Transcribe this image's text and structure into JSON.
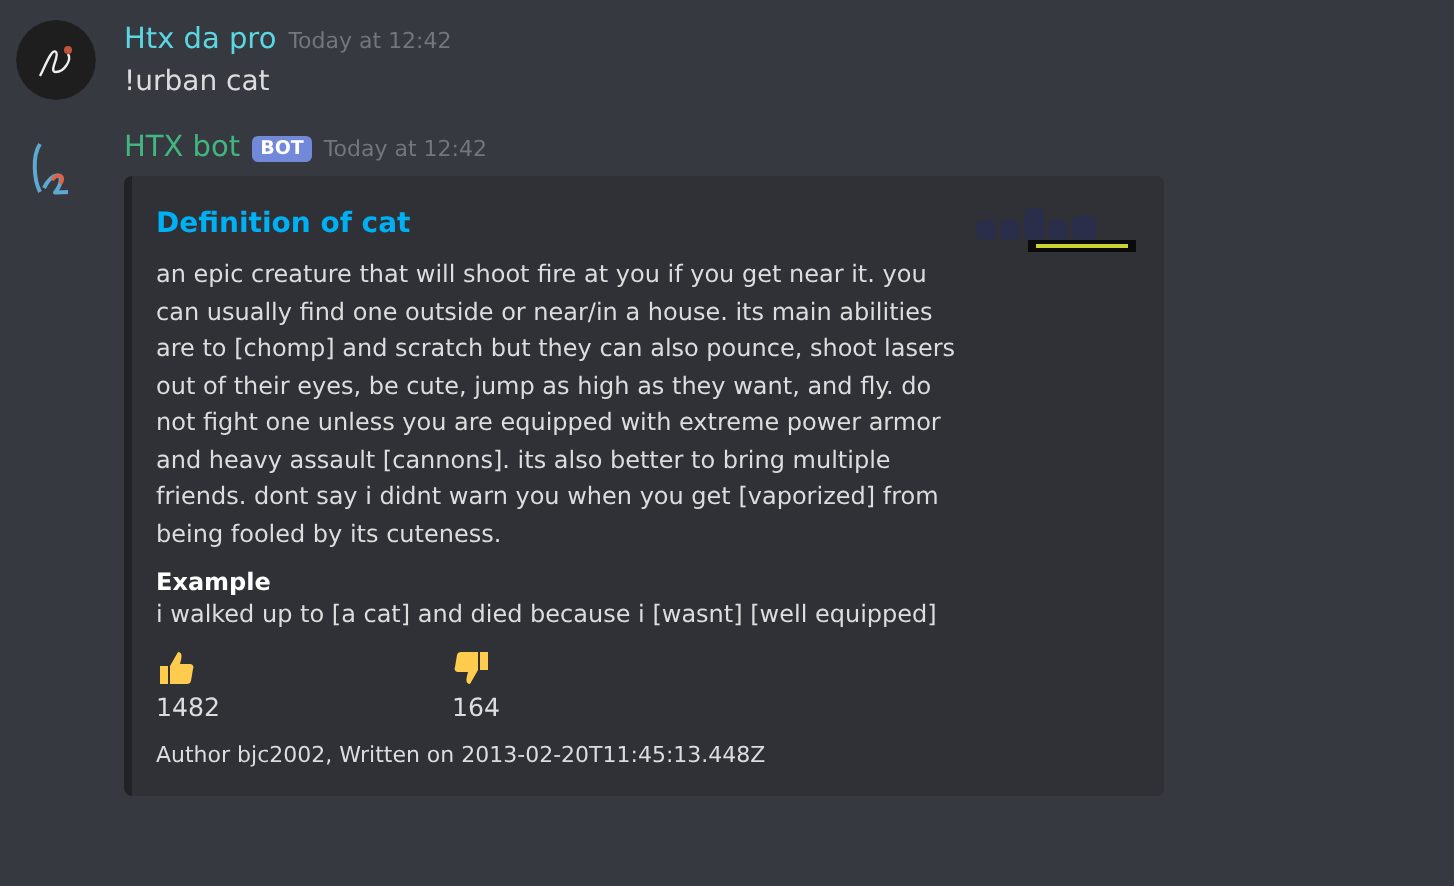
{
  "messages": [
    {
      "author": "Htx da pro",
      "color": "#5ad8e2",
      "bot": false,
      "timestamp": "Today at 12:42",
      "text": "!urban cat"
    },
    {
      "author": "HTX bot",
      "color": "#43b581",
      "bot": true,
      "badge": "BOT",
      "timestamp": "Today at 12:42",
      "embed": {
        "title": "Definition of cat",
        "description": "an epic creature that will shoot fire at you if you get near it. you can usually find one outside or near/in a house. its main abilities are to [chomp] and scratch but they can also pounce, shoot lasers out of their eyes, be cute, jump as high as they want, and fly. do not fight one unless you are equipped with extreme power armor and heavy assault [cannons]. its also better to bring multiple friends. dont say i didnt warn you when you get [vaporized] from being fooled by its cuteness.",
        "fields": [
          {
            "name": "Example",
            "value": "i walked up to [a cat] and died because i [wasnt] [well equipped]"
          }
        ],
        "votes": [
          {
            "kind": "up",
            "count": "1482"
          },
          {
            "kind": "down",
            "count": "164"
          }
        ],
        "footer": "Author bjc2002, Written on 2013-02-20T11:45:13.448Z"
      }
    }
  ]
}
